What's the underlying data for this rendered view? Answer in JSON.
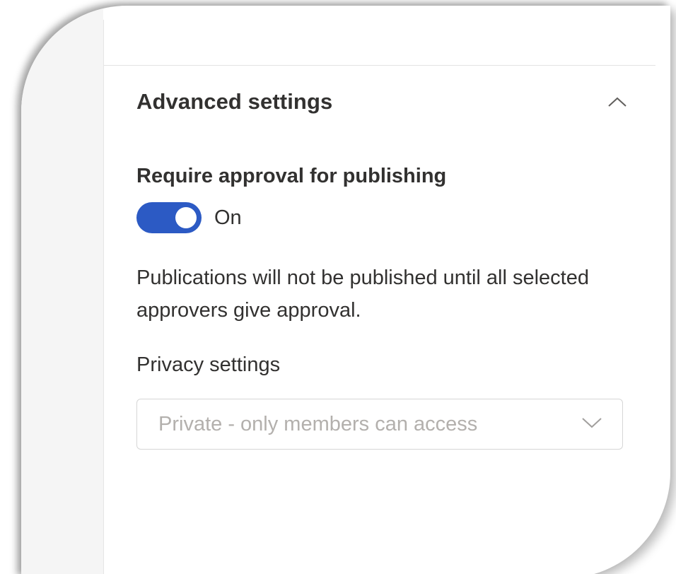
{
  "advanced_settings": {
    "title": "Advanced settings",
    "collapse_icon": "chevron-up-icon",
    "require_approval": {
      "label": "Require approval for publishing",
      "toggle_state": "On",
      "enabled": true,
      "description": "Publications will not be published until all selected approvers give approval."
    },
    "privacy": {
      "label": "Privacy settings",
      "selected_value": "Private - only members can access",
      "dropdown_icon": "chevron-down-icon"
    }
  },
  "colors": {
    "toggle_on": "#2c5ac4",
    "text_primary": "#323130",
    "text_disabled": "#b3b0ad",
    "border": "#d6d6d6"
  }
}
